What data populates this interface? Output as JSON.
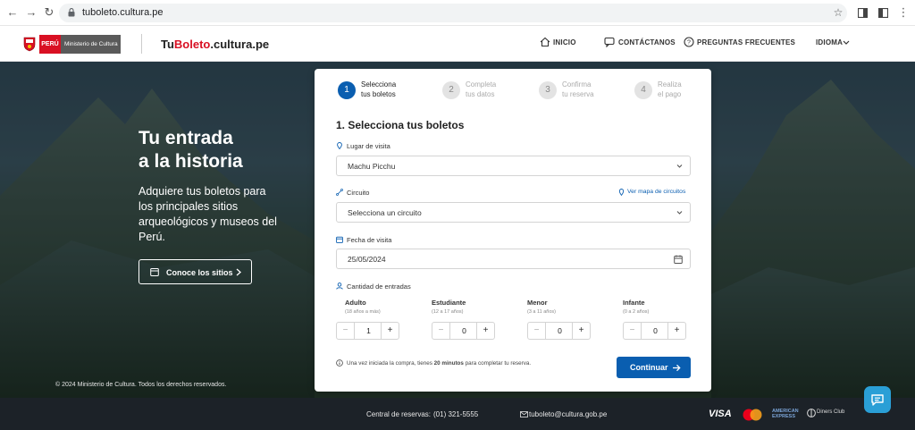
{
  "browser": {
    "url": "tuboleto.cultura.pe"
  },
  "header": {
    "flag_label": "PERÚ",
    "ministry_label": "Ministerio de Cultura",
    "brand_prefix": "Tu",
    "brand_accent": "Boleto",
    "brand_suffix": ".cultura.pe",
    "nav": {
      "home": "INICIO",
      "contact": "CONTÁCTANOS",
      "faq": "PREGUNTAS FRECUENTES",
      "language": "IDIOMA"
    }
  },
  "hero": {
    "title_line1": "Tu entrada",
    "title_line2": "a la historia",
    "subtitle": "Adquiere tus boletos para los principales sitios arqueológicos y museos del Perú.",
    "cta": "Conoce los sitios",
    "copyright": "© 2024 Ministerio de Cultura. Todos los derechos reservados."
  },
  "steps": [
    {
      "number": "1",
      "line1": "Selecciona",
      "line2": "tus boletos",
      "active": true
    },
    {
      "number": "2",
      "line1": "Completa",
      "line2": "tus datos",
      "active": false
    },
    {
      "number": "3",
      "line1": "Confirma",
      "line2": "tu reserva",
      "active": false
    },
    {
      "number": "4",
      "line1": "Realiza",
      "line2": "el pago",
      "active": false
    }
  ],
  "form": {
    "title": "1. Selecciona tus boletos",
    "place_label": "Lugar de visita",
    "place_value": "Machu Picchu",
    "circuit_label": "Circuito",
    "circuit_map_link": "Ver mapa de circuitos",
    "circuit_placeholder": "Selecciona un circuito",
    "date_label": "Fecha de visita",
    "date_value": "25/05/2024",
    "quantity_label": "Cantidad de entradas",
    "ticket_types": [
      {
        "name": "Adulto",
        "note": "(18 años a más)",
        "qty": "1"
      },
      {
        "name": "Estudiante",
        "note": "(12 a 17 años)",
        "qty": "0"
      },
      {
        "name": "Menor",
        "note": "(3 a 11 años)",
        "qty": "0"
      },
      {
        "name": "Infante",
        "note": "(0 a 2 años)",
        "qty": "0"
      }
    ],
    "notice_prefix": "Una vez iniciada la compra, tienes ",
    "notice_bold": "20 minutos",
    "notice_suffix": " para completar tu reserva.",
    "continue_label": "Continuar"
  },
  "footer": {
    "reservations_label": "Central de reservas:",
    "reservations_phone": "(01) 321-5555",
    "email": "tuboleto@cultura.gob.pe",
    "visa": "VISA",
    "amex_line1": "AMERICAN",
    "amex_line2": "EXPRESS",
    "diners": "Diners Club"
  },
  "colors": {
    "primary": "#0a5eb0",
    "brand_red": "#d91023",
    "footer_bg": "#1c2228"
  }
}
